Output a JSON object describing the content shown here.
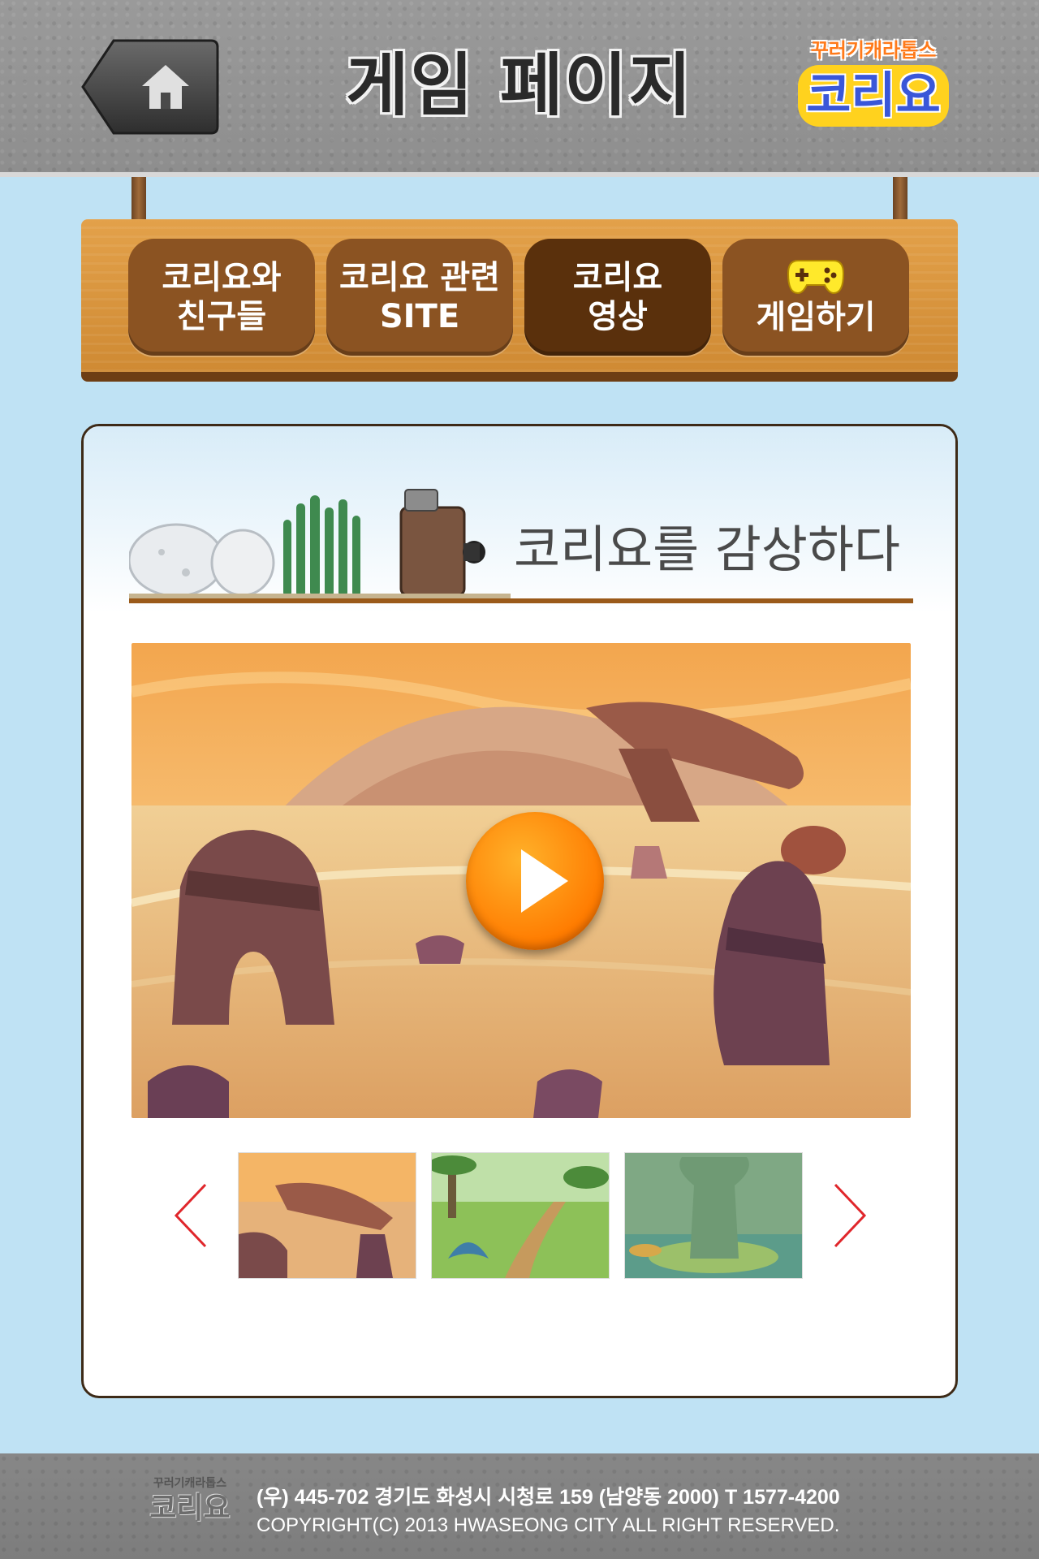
{
  "header": {
    "title": "게임 페이지",
    "home_icon": "home-icon",
    "logo_sub": "꾸러기캐라톱스",
    "logo_main": "코리요"
  },
  "nav": {
    "items": [
      {
        "line1": "코리요와",
        "line2": "친구들",
        "active": false
      },
      {
        "line1": "코리요 관련",
        "line2": "SITE",
        "active": false
      },
      {
        "line1": "코리요",
        "line2": "영상",
        "active": true
      },
      {
        "line1": "게임하기",
        "icon": "gamepad-icon",
        "active": false
      }
    ]
  },
  "main": {
    "section_title": "코리요를 감상하다",
    "play_icon": "play-icon",
    "prev_icon": "chevron-left-icon",
    "next_icon": "chevron-right-icon"
  },
  "footer": {
    "logo_sub": "꾸러기캐라톱스",
    "logo_main": "코리요",
    "address": "(우) 445-702 경기도 화성시 시청로 159 (남양동 2000) T 1577-4200",
    "copyright": "COPYRIGHT(C) 2013 HWASEONG CITY ALL RIGHT RESERVED."
  },
  "colors": {
    "background": "#bfe2f4",
    "nav_button": "#8b5322",
    "nav_button_active": "#5a300c",
    "play_button": "#ff8a00",
    "arrow": "#e0262b"
  }
}
